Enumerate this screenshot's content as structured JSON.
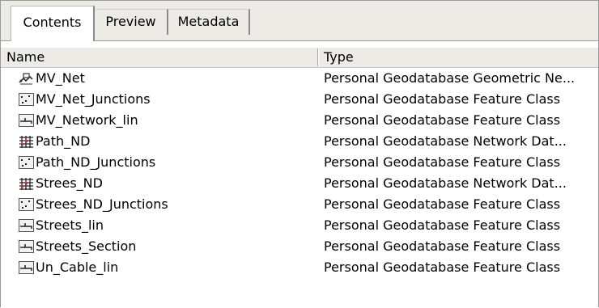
{
  "tabs": [
    {
      "label": "Contents",
      "active": true
    },
    {
      "label": "Preview",
      "active": false
    },
    {
      "label": "Metadata",
      "active": false
    }
  ],
  "columns": {
    "name": "Name",
    "type": "Type"
  },
  "rows": [
    {
      "name": "MV_Net",
      "type": "Personal Geodatabase Geometric Ne...",
      "icon": "geometric-network-icon"
    },
    {
      "name": "MV_Net_Junctions",
      "type": "Personal Geodatabase Feature Class",
      "icon": "point-feature-class-icon"
    },
    {
      "name": "MV_Network_lin",
      "type": "Personal Geodatabase Feature Class",
      "icon": "line-feature-class-icon"
    },
    {
      "name": "Path_ND",
      "type": "Personal Geodatabase Network Dat...",
      "icon": "network-dataset-icon"
    },
    {
      "name": "Path_ND_Junctions",
      "type": "Personal Geodatabase Feature Class",
      "icon": "point-feature-class-icon"
    },
    {
      "name": "Strees_ND",
      "type": "Personal Geodatabase Network Dat...",
      "icon": "network-dataset-icon"
    },
    {
      "name": "Strees_ND_Junctions",
      "type": "Personal Geodatabase Feature Class",
      "icon": "point-feature-class-icon"
    },
    {
      "name": "Streets_lin",
      "type": "Personal Geodatabase Feature Class",
      "icon": "line-feature-class-icon"
    },
    {
      "name": "Streets_Section",
      "type": "Personal Geodatabase Feature Class",
      "icon": "line-feature-class-icon"
    },
    {
      "name": "Un_Cable_lin",
      "type": "Personal Geodatabase Feature Class",
      "icon": "line-feature-class-icon"
    }
  ]
}
